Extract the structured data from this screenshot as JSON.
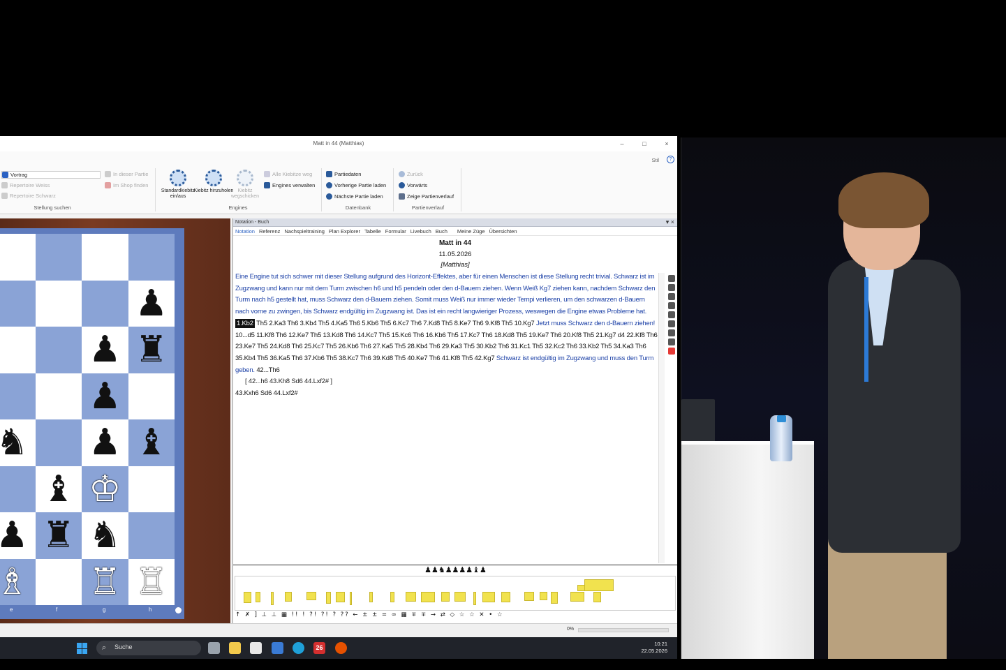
{
  "window": {
    "title": "Matt in 44  (Matthias)",
    "controls": {
      "minimize": "–",
      "maximize": "□",
      "close": "×"
    },
    "topright_label": "Stil",
    "help": "?"
  },
  "ribbon": {
    "vortrag": "Vortrag",
    "repertoire_weiss": "Repertoire Weiss",
    "repertoire_schwarz": "Repertoire Schwarz",
    "in_dieser_partie": "In dieser Partie",
    "im_shop_finden": "Im Shop finden",
    "group_stellung": "Stellung suchen",
    "btn_standardkiebitz": "Standardkiebitz ein/aus",
    "btn_kiebitz_hinzuholen": "Kiebitz hinzuholen",
    "btn_kiebitz_wegschicken": "Kiebitz wegschicken",
    "alle_kiebitze_weg": "Alle Kiebitze weg",
    "engines_verwalten": "Engines verwalten",
    "group_engines": "Engines",
    "partiedaten": "Partiedaten",
    "vorherige_partie": "Vorherige Partie laden",
    "naechste_partie": "Nächste Partie laden",
    "group_datenbank": "Datenbank",
    "zurueck": "Zurück",
    "vorwaerts": "Vorwärts",
    "zeige_partienverlauf": "Zeige Partienverlauf",
    "group_partienverlauf": "Partienverlauf"
  },
  "board": {
    "files": [
      "e",
      "f",
      "g",
      "h"
    ]
  },
  "notation": {
    "panel_title": "Notation - Buch",
    "tabs": [
      "Notation",
      "Referenz",
      "Nachspieltraining",
      "Plan Explorer",
      "Tabelle",
      "Formular",
      "Livebuch",
      "Buch",
      "Meine Züge",
      "Übersichten"
    ],
    "game_title": "Matt in 44",
    "date": "11.05.2026",
    "annotator": "[Matthias]",
    "intro_comment": "Eine Engine tut sich schwer mit dieser Stellung aufgrund des Horizont-Effektes, aber für einen Menschen ist diese Stellung recht trivial. Schwarz ist im Zugzwang und kann nur mit dem Turm zwischen h6 und h5 pendeln oder den d-Bauern ziehen. Wenn Weiß Kg7 ziehen kann, nachdem Schwarz den Turm nach h5 gestellt hat, muss Schwarz den d-Bauern ziehen. Somit muss Weiß nur immer wieder Tempi verlieren, um den schwarzen d-Bauern nach vorne zu zwingen, bis Schwarz endgültig im Zugzwang ist. Das ist ein recht langwieriger Prozess, weswegen die Engine etwas Probleme hat.",
    "selected_move": "1.Kb2",
    "moves_1": "Th5 2.Ka3 Th6 3.Kb4 Th5 4.Ka5 Th6 5.Kb6 Th5 6.Kc7 Th6 7.Kd8 Th5 8.Ke7 Th6 9.Kf8 Th5 10.Kg7",
    "comment_2": "Jetzt muss Schwarz den d-Bauern ziehen!",
    "moves_2": "10...d5 11.Kf8 Th6 12.Ke7 Th5 13.Kd8 Th6 14.Kc7 Th5 15.Kc6 Th6 16.Kb6 Th5 17.Kc7 Th6 18.Kd8 Th5 19.Ke7 Th6 20.Kf8 Th5 21.Kg7 d4 22.Kf8 Th6 23.Ke7 Th5 24.Kd8 Th6 25.Kc7 Th5 26.Kb6 Th6 27.Ka5 Th5 28.Kb4 Th6 29.Ka3 Th5 30.Kb2 Th6 31.Kc1 Th5 32.Kc2 Th6 33.Kb2 Th5 34.Ka3 Th6 35.Kb4 Th5 36.Ka5 Th6 37.Kb6 Th5 38.Kc7 Th6 39.Kd8 Th5 40.Ke7 Th6 41.Kf8 Th5 42.Kg7",
    "comment_3": "Schwarz ist endgültig im Zugzwang und muss den Turm geben.",
    "moves_3": "42...Th6",
    "variation": "[ 42...h6 43.Kh8 Sd6 44.Lxf2# ]",
    "final_line": "43.Kxh6 Sd6 44.Lxf2#",
    "material": "♟♟♞♟♟♟♟♝♟",
    "symbols": "↑ ✗ ] ⊥ ⊥ ▦ !! ! ?! ?! ? ?? ← ± ± = ∞ ▦ ∓ ∓ → ⇄ ◇ ☆ ☆ ✕ • ☆"
  },
  "status": {
    "percent": "0%",
    "progress": 0
  },
  "taskbar": {
    "search": "Suche",
    "time": "10:21",
    "date": "22.05.2026"
  },
  "colors": {
    "accent": "#2b62c3",
    "comment_blue": "#1a3fa6",
    "board_dark": "#8aa3d6",
    "board_light": "#ffffff",
    "eval_bar": "#f1e24e"
  }
}
